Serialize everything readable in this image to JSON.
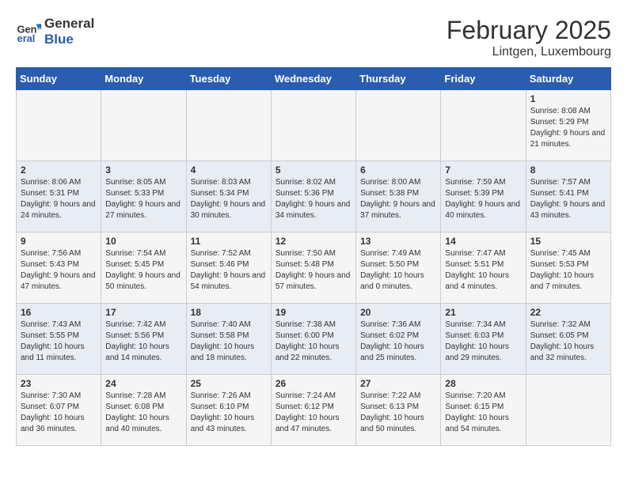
{
  "logo": {
    "line1": "General",
    "line2": "Blue"
  },
  "title": "February 2025",
  "subtitle": "Lintgen, Luxembourg",
  "weekdays": [
    "Sunday",
    "Monday",
    "Tuesday",
    "Wednesday",
    "Thursday",
    "Friday",
    "Saturday"
  ],
  "weeks": [
    [
      {
        "day": "",
        "info": ""
      },
      {
        "day": "",
        "info": ""
      },
      {
        "day": "",
        "info": ""
      },
      {
        "day": "",
        "info": ""
      },
      {
        "day": "",
        "info": ""
      },
      {
        "day": "",
        "info": ""
      },
      {
        "day": "1",
        "info": "Sunrise: 8:08 AM\nSunset: 5:29 PM\nDaylight: 9 hours and 21 minutes."
      }
    ],
    [
      {
        "day": "2",
        "info": "Sunrise: 8:06 AM\nSunset: 5:31 PM\nDaylight: 9 hours and 24 minutes."
      },
      {
        "day": "3",
        "info": "Sunrise: 8:05 AM\nSunset: 5:33 PM\nDaylight: 9 hours and 27 minutes."
      },
      {
        "day": "4",
        "info": "Sunrise: 8:03 AM\nSunset: 5:34 PM\nDaylight: 9 hours and 30 minutes."
      },
      {
        "day": "5",
        "info": "Sunrise: 8:02 AM\nSunset: 5:36 PM\nDaylight: 9 hours and 34 minutes."
      },
      {
        "day": "6",
        "info": "Sunrise: 8:00 AM\nSunset: 5:38 PM\nDaylight: 9 hours and 37 minutes."
      },
      {
        "day": "7",
        "info": "Sunrise: 7:59 AM\nSunset: 5:39 PM\nDaylight: 9 hours and 40 minutes."
      },
      {
        "day": "8",
        "info": "Sunrise: 7:57 AM\nSunset: 5:41 PM\nDaylight: 9 hours and 43 minutes."
      }
    ],
    [
      {
        "day": "9",
        "info": "Sunrise: 7:56 AM\nSunset: 5:43 PM\nDaylight: 9 hours and 47 minutes."
      },
      {
        "day": "10",
        "info": "Sunrise: 7:54 AM\nSunset: 5:45 PM\nDaylight: 9 hours and 50 minutes."
      },
      {
        "day": "11",
        "info": "Sunrise: 7:52 AM\nSunset: 5:46 PM\nDaylight: 9 hours and 54 minutes."
      },
      {
        "day": "12",
        "info": "Sunrise: 7:50 AM\nSunset: 5:48 PM\nDaylight: 9 hours and 57 minutes."
      },
      {
        "day": "13",
        "info": "Sunrise: 7:49 AM\nSunset: 5:50 PM\nDaylight: 10 hours and 0 minutes."
      },
      {
        "day": "14",
        "info": "Sunrise: 7:47 AM\nSunset: 5:51 PM\nDaylight: 10 hours and 4 minutes."
      },
      {
        "day": "15",
        "info": "Sunrise: 7:45 AM\nSunset: 5:53 PM\nDaylight: 10 hours and 7 minutes."
      }
    ],
    [
      {
        "day": "16",
        "info": "Sunrise: 7:43 AM\nSunset: 5:55 PM\nDaylight: 10 hours and 11 minutes."
      },
      {
        "day": "17",
        "info": "Sunrise: 7:42 AM\nSunset: 5:56 PM\nDaylight: 10 hours and 14 minutes."
      },
      {
        "day": "18",
        "info": "Sunrise: 7:40 AM\nSunset: 5:58 PM\nDaylight: 10 hours and 18 minutes."
      },
      {
        "day": "19",
        "info": "Sunrise: 7:38 AM\nSunset: 6:00 PM\nDaylight: 10 hours and 22 minutes."
      },
      {
        "day": "20",
        "info": "Sunrise: 7:36 AM\nSunset: 6:02 PM\nDaylight: 10 hours and 25 minutes."
      },
      {
        "day": "21",
        "info": "Sunrise: 7:34 AM\nSunset: 6:03 PM\nDaylight: 10 hours and 29 minutes."
      },
      {
        "day": "22",
        "info": "Sunrise: 7:32 AM\nSunset: 6:05 PM\nDaylight: 10 hours and 32 minutes."
      }
    ],
    [
      {
        "day": "23",
        "info": "Sunrise: 7:30 AM\nSunset: 6:07 PM\nDaylight: 10 hours and 36 minutes."
      },
      {
        "day": "24",
        "info": "Sunrise: 7:28 AM\nSunset: 6:08 PM\nDaylight: 10 hours and 40 minutes."
      },
      {
        "day": "25",
        "info": "Sunrise: 7:26 AM\nSunset: 6:10 PM\nDaylight: 10 hours and 43 minutes."
      },
      {
        "day": "26",
        "info": "Sunrise: 7:24 AM\nSunset: 6:12 PM\nDaylight: 10 hours and 47 minutes."
      },
      {
        "day": "27",
        "info": "Sunrise: 7:22 AM\nSunset: 6:13 PM\nDaylight: 10 hours and 50 minutes."
      },
      {
        "day": "28",
        "info": "Sunrise: 7:20 AM\nSunset: 6:15 PM\nDaylight: 10 hours and 54 minutes."
      },
      {
        "day": "",
        "info": ""
      }
    ]
  ]
}
